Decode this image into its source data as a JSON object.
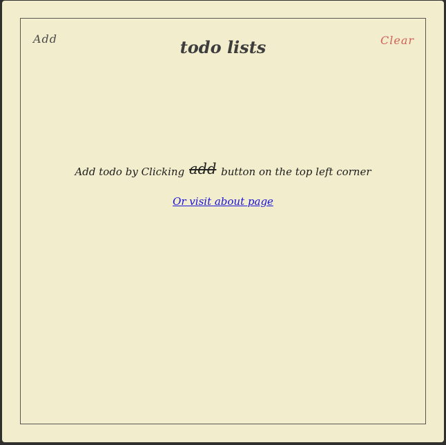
{
  "header": {
    "add_label": "Add",
    "title": "todo lists",
    "clear_label": "Clear"
  },
  "empty_state": {
    "hint_prefix": "Add todo by Clicking",
    "hint_button_word": "add",
    "hint_suffix": "button on the top left corner",
    "about_link": "Or visit about page"
  },
  "colors": {
    "background": "#f2edcc",
    "clear": "#d0615a",
    "link": "#1a12d8"
  }
}
